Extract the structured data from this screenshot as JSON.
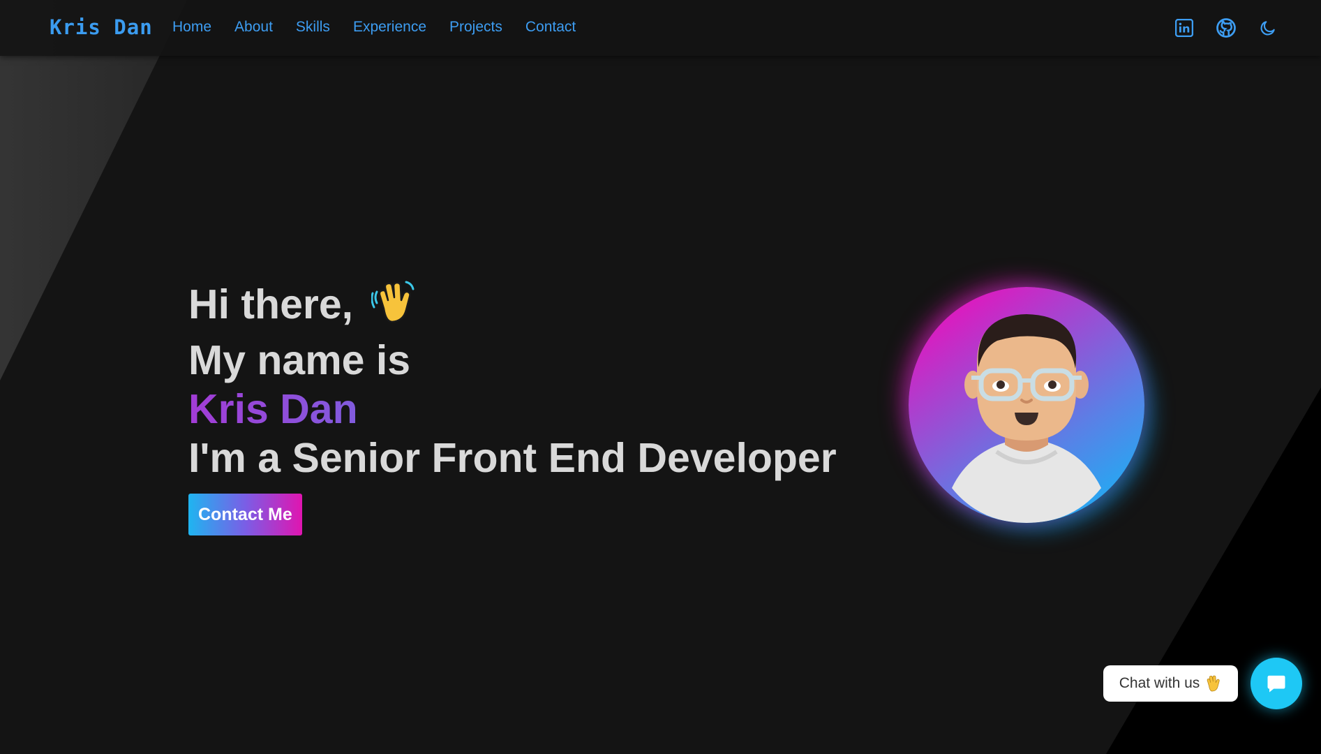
{
  "brand": {
    "logo_text": "Kris Dan",
    "accent": "#3d9df2"
  },
  "nav": {
    "items": [
      {
        "label": "Home"
      },
      {
        "label": "About"
      },
      {
        "label": "Skills"
      },
      {
        "label": "Experience"
      },
      {
        "label": "Projects"
      },
      {
        "label": "Contact"
      }
    ]
  },
  "header_icons": [
    "linkedin-icon",
    "github-icon",
    "moon-icon"
  ],
  "hero": {
    "greeting": "Hi there,",
    "greeting_emoji": "waving-hand-icon",
    "intro": "My name is",
    "name": "Kris Dan",
    "role": "I'm a Senior Front End Developer",
    "cta_label": "Contact Me"
  },
  "avatar": {
    "icon": "avatar-illustration",
    "gradient": [
      "#ff00b4",
      "#0bbcf8"
    ]
  },
  "chat": {
    "pill_label": "Chat with us",
    "pill_emoji": "waving-hand-icon",
    "button_icon": "chat-bubble-icon",
    "button_color": "#1ec8f5"
  }
}
